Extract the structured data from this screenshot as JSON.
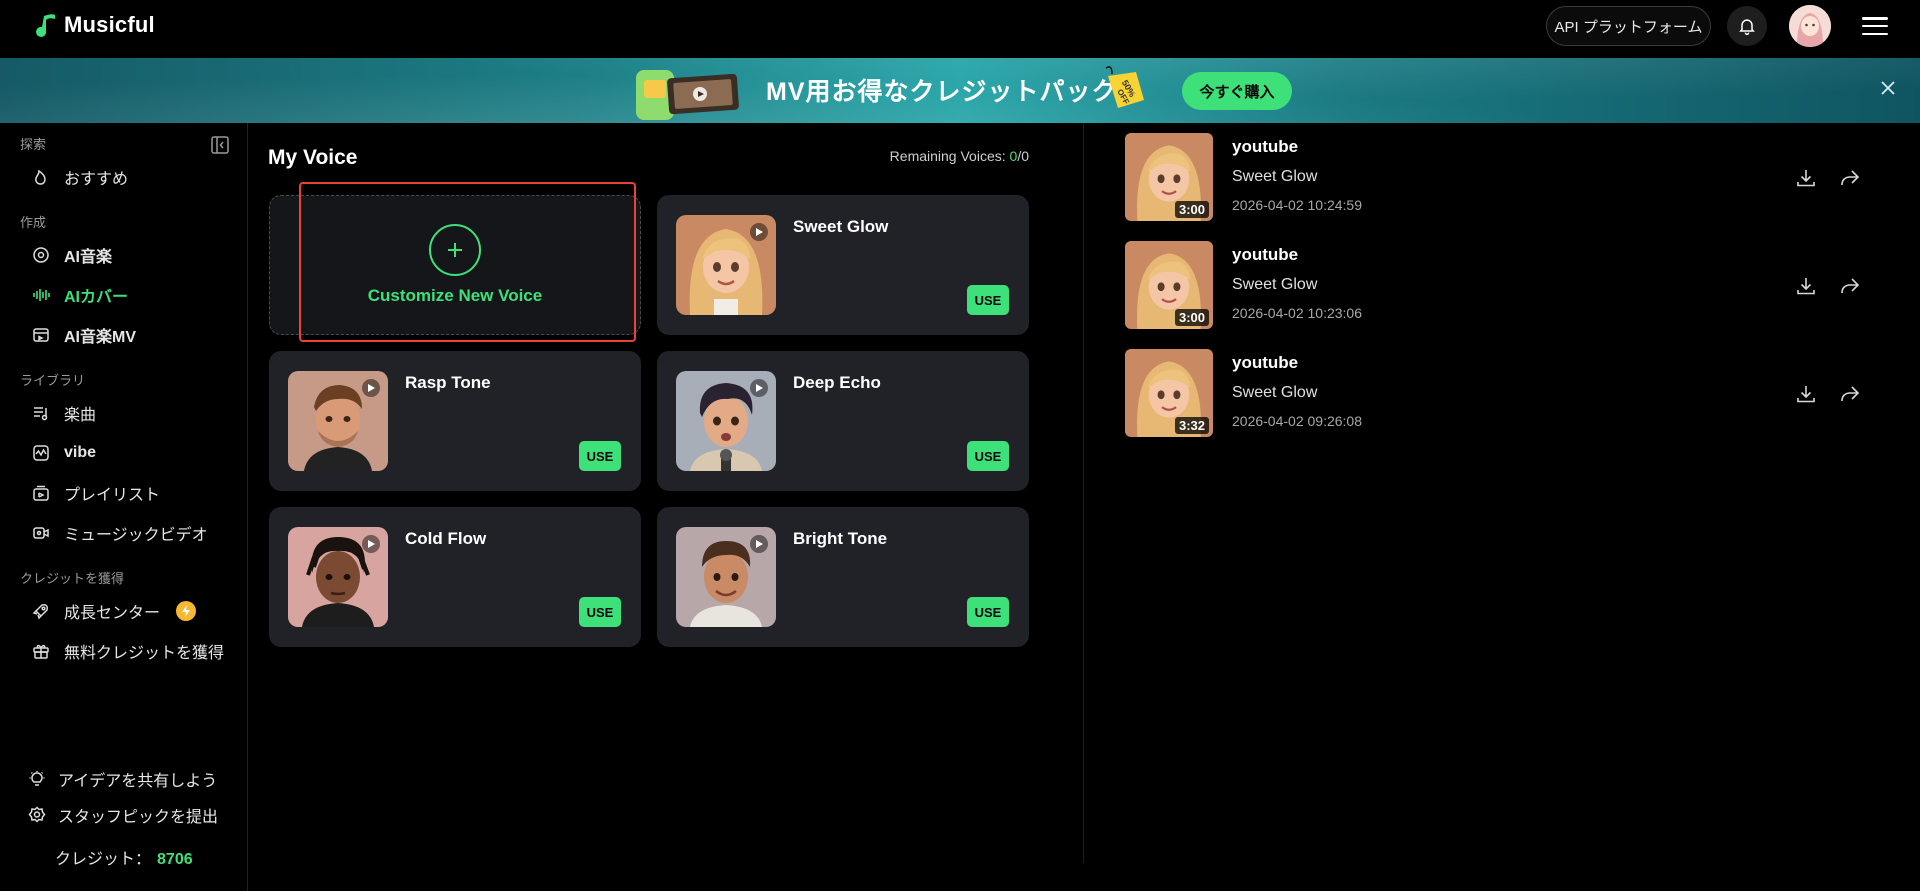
{
  "app": {
    "name": "Musicful"
  },
  "header": {
    "api_label": "API プラットフォーム"
  },
  "banner": {
    "title": "MV用お得なクレジットパック",
    "tag": "50% OFF",
    "cta": "今すぐ購入"
  },
  "sidebar": {
    "sections": [
      {
        "label": "探索",
        "items": [
          {
            "label": "おすすめ",
            "icon": "flame-icon"
          }
        ]
      },
      {
        "label": "作成",
        "items": [
          {
            "label": "AI音楽",
            "icon": "disc-icon"
          },
          {
            "label": "AIカバー",
            "icon": "waveform-icon",
            "active": true
          },
          {
            "label": "AI音楽MV",
            "icon": "film-icon"
          }
        ]
      },
      {
        "label": "ライブラリ",
        "items": [
          {
            "label": "楽曲",
            "icon": "music-list-icon"
          },
          {
            "label": "vibe",
            "icon": "vibe-icon"
          },
          {
            "label": "プレイリスト",
            "icon": "playlist-icon"
          },
          {
            "label": "ミュージックビデオ",
            "icon": "video-icon"
          }
        ]
      },
      {
        "label": "クレジットを獲得",
        "items": [
          {
            "label": "成長センター",
            "icon": "rocket-icon"
          },
          {
            "label": "無料クレジットを獲得",
            "icon": "gift-icon"
          }
        ]
      }
    ],
    "footer": {
      "share_idea": "アイデアを共有しよう",
      "submit_pick": "スタッフピックを提出",
      "credits_label": "クレジット：",
      "credits_value": "8706"
    }
  },
  "voice": {
    "title": "My Voice",
    "remaining_label": "Remaining Voices: ",
    "remaining_used": "0",
    "remaining_total": "/0",
    "customize_label": "Customize New Voice",
    "use_label": "USE",
    "cards": [
      {
        "name": "Sweet Glow"
      },
      {
        "name": "Rasp Tone"
      },
      {
        "name": "Deep Echo"
      },
      {
        "name": "Cold Flow"
      },
      {
        "name": "Bright Tone"
      }
    ]
  },
  "history": [
    {
      "source": "youtube",
      "name": "Sweet Glow",
      "date": "2026-04-02 10:24:59",
      "duration": "3:00"
    },
    {
      "source": "youtube",
      "name": "Sweet Glow",
      "date": "2026-04-02 10:23:06",
      "duration": "3:00"
    },
    {
      "source": "youtube",
      "name": "Sweet Glow",
      "date": "2026-04-02 09:26:08",
      "duration": "3:32"
    }
  ],
  "colors": {
    "accent": "#3ee07a",
    "card": "#202227",
    "highlight": "#e8433a"
  }
}
